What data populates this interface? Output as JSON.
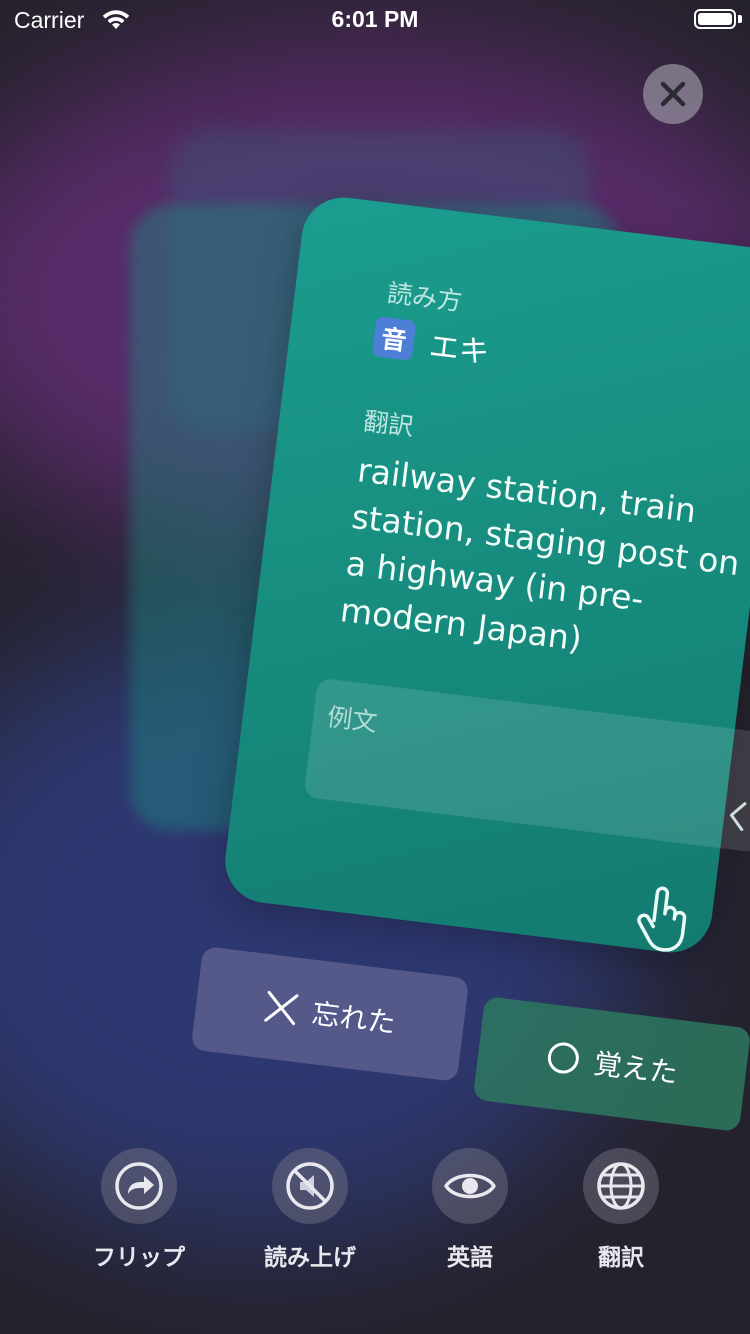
{
  "status_bar": {
    "carrier": "Carrier",
    "time": "6:01 PM"
  },
  "card": {
    "reading_label": "読み方",
    "onyomi_badge": "音",
    "reading_value": "エキ",
    "translation_label": "翻訳",
    "translation_text": "railway station, train station, staging post on a highway (in pre-modern Japan)",
    "example_label": "例文"
  },
  "actions": {
    "forgot_label": "忘れた",
    "remembered_label": "覚えた"
  },
  "toolbar": {
    "items": [
      {
        "label": "フリップ",
        "icon": "flip-arrow-icon"
      },
      {
        "label": "読み上げ",
        "icon": "speaker-muted-icon"
      },
      {
        "label": "英語",
        "icon": "eye-icon"
      },
      {
        "label": "翻訳",
        "icon": "globe-icon"
      }
    ]
  },
  "colors": {
    "card_teal": "#1b9d8f",
    "onyomi_badge": "#4e7fd6",
    "remembered_green": "#2d785f",
    "forgot_gray": "#828aaa"
  }
}
